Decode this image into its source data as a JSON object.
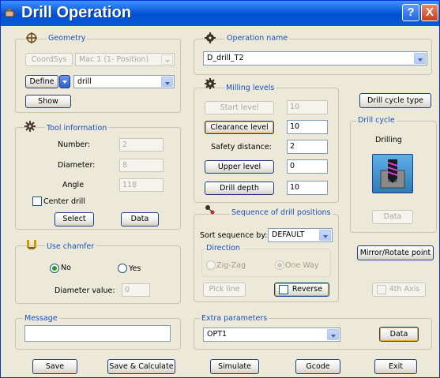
{
  "window": {
    "title": "Drill Operation",
    "help_label": "?",
    "close_label": "X"
  },
  "geometry": {
    "group_title": "Geometry",
    "coordsys_label": "CoordSys",
    "coordsys_value": "Mac 1 (1- Position)",
    "define_label": "Define",
    "type_value": "drill",
    "show_label": "Show"
  },
  "tool_info": {
    "group_title": "Tool information",
    "number_label": "Number:",
    "number_value": "2",
    "diameter_label": "Diameter:",
    "diameter_value": "8",
    "angle_label": "Angle",
    "angle_value": "118",
    "center_drill_label": "Center drill",
    "select_label": "Select",
    "data_label": "Data"
  },
  "chamfer": {
    "group_title": "Use chamfer",
    "no_label": "No",
    "yes_label": "Yes",
    "diameter_label": "Diameter value:",
    "diameter_value": "0"
  },
  "message": {
    "group_title": "Message",
    "value": ""
  },
  "operation": {
    "group_title": "Operation name",
    "value": "D_drill_T2"
  },
  "milling_levels": {
    "group_title": "Milling levels",
    "start_label": "Start level",
    "start_value": "10",
    "clearance_label": "Clearance level",
    "clearance_value": "10",
    "safety_label": "Safety distance:",
    "safety_value": "2",
    "upper_label": "Upper level",
    "upper_value": "0",
    "depth_label": "Drill depth",
    "depth_value": "10"
  },
  "sequence": {
    "group_title": "Sequence of drill positions",
    "sort_label": "Sort sequence by:",
    "sort_value": "DEFAULT",
    "direction_title": "Direction",
    "zigzag_label": "Zig-Zag",
    "oneway_label": "One Way",
    "pickline_label": "Pick line",
    "reverse_label": "Reverse"
  },
  "drill_cycle": {
    "type_button": "Drill cycle type",
    "group_title": "Drill cycle",
    "name": "Drilling",
    "data_label": "Data"
  },
  "right_buttons": {
    "mirror_label": "Mirror/Rotate point",
    "fourth_axis_label": "4th Axis"
  },
  "extra": {
    "group_title": "Extra parameters",
    "value": "OPT1",
    "data_label": "Data"
  },
  "footer": {
    "save_label": "Save",
    "save_calc_label": "Save & Calculate",
    "simulate_label": "Simulate",
    "gcode_label": "Gcode",
    "exit_label": "Exit"
  },
  "colors": {
    "title_bar": "#0a5ad8",
    "group_title": "#1b4fbf",
    "window_bg": "#ece9d8"
  },
  "icons": [
    "drill-operation-app-icon",
    "geometry-icon",
    "tool-icon",
    "chamfer-icon",
    "operation-icon",
    "milling-levels-icon",
    "sequence-icon",
    "drilling-cycle-icon"
  ]
}
